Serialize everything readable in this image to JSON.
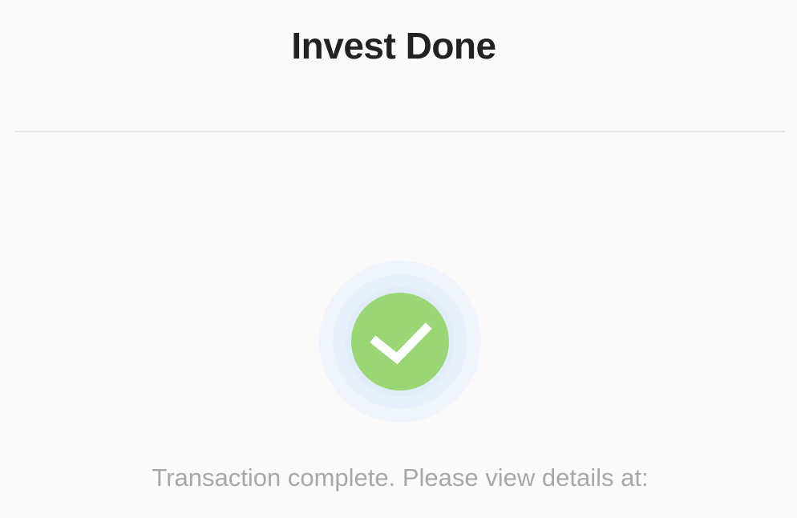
{
  "header": {
    "title": "Invest Done"
  },
  "status": {
    "icon": "checkmark-icon",
    "accent_color": "#9ad774",
    "message": "Transaction complete. Please view details at:"
  }
}
